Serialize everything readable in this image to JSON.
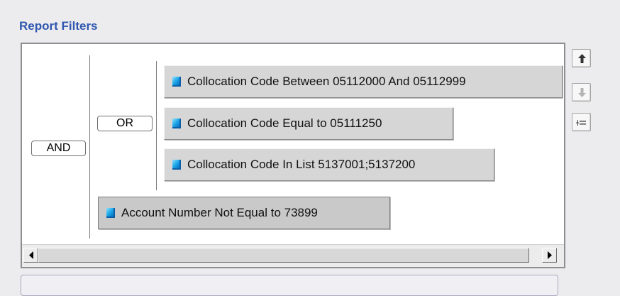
{
  "panel": {
    "title": "Report Filters"
  },
  "operators": {
    "and_label": "AND",
    "or_label": "OR"
  },
  "filters": [
    {
      "label": "Collocation Code Between 05112000 And 05112999",
      "icon": "filter-icon"
    },
    {
      "label": "Collocation Code Equal to 05111250",
      "icon": "filter-icon"
    },
    {
      "label": "Collocation Code In List 5137001;5137200",
      "icon": "filter-icon"
    },
    {
      "label": "Account Number Not Equal to 73899",
      "icon": "filter-icon",
      "selected": true
    }
  ],
  "toolbar": {
    "move_up_icon": "arrow-up-icon",
    "move_down_icon": "arrow-down-icon",
    "indent_icon": "indent-icon"
  },
  "colors": {
    "title": "#3058b0",
    "filter_icon": "#18a3e6"
  }
}
